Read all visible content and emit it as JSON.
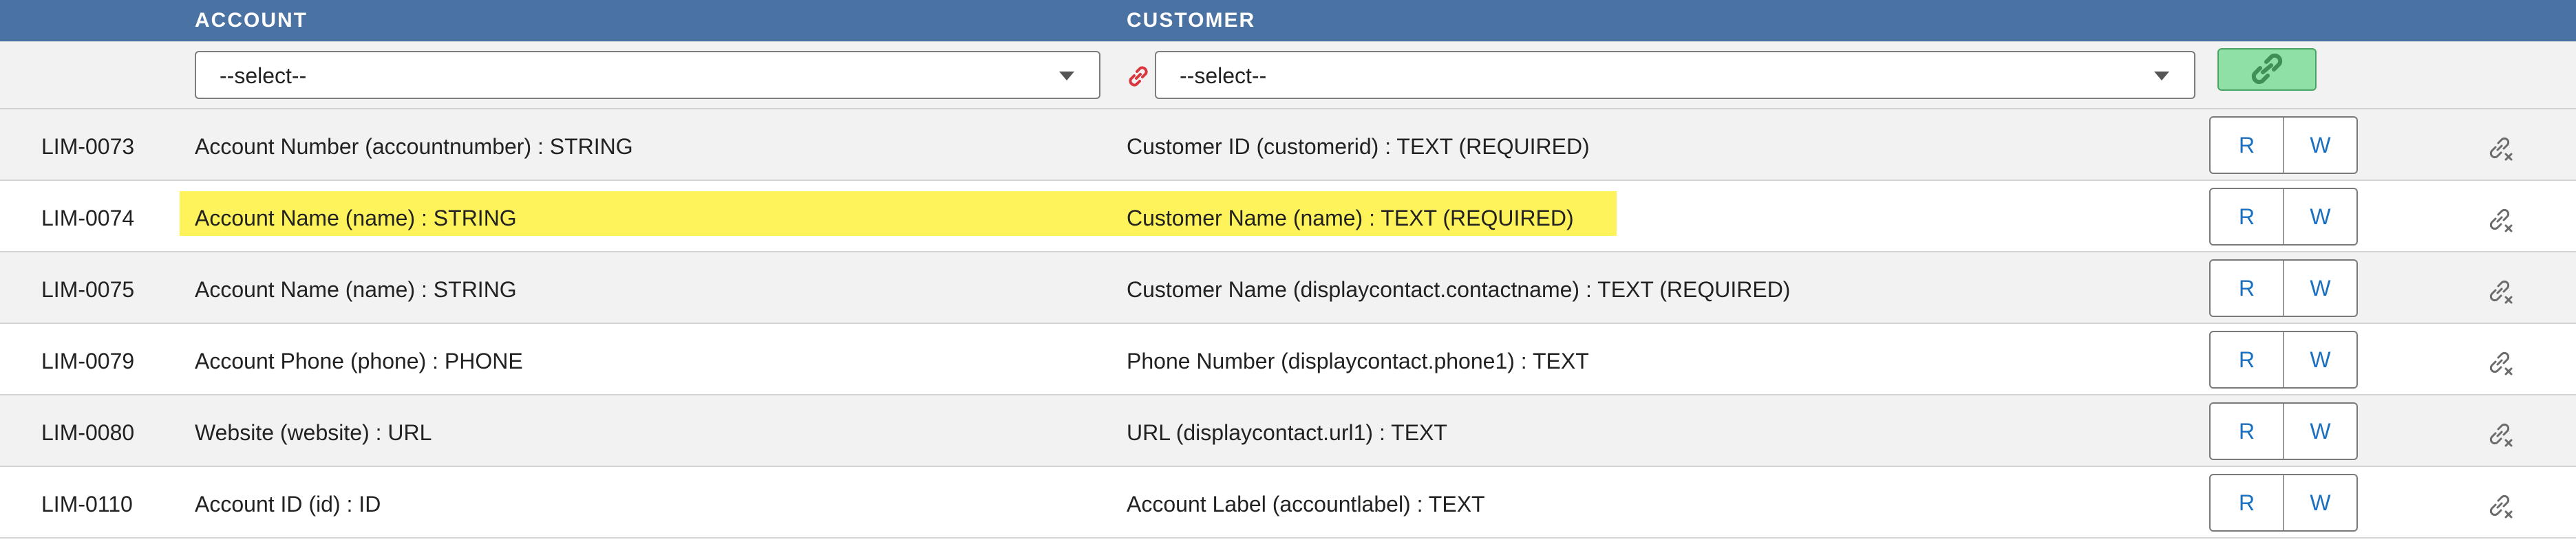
{
  "header": {
    "account_label": "ACCOUNT",
    "customer_label": "CUSTOMER"
  },
  "filter": {
    "account_select": "--select--",
    "customer_select": "--select--",
    "link_icon": "chain-link-icon",
    "link_button_icon": "link-icon"
  },
  "colors": {
    "header_bg": "#4a72a3",
    "highlight": "#fff35c",
    "link_button_bg": "#8fe0a6",
    "rw_text": "#1a6fc0",
    "chain_red": "#d9363e"
  },
  "rows": [
    {
      "id": "LIM-0073",
      "account": "Account Number (accountnumber) : STRING",
      "customer": "Customer ID (customerid) : TEXT (REQUIRED)",
      "r": "R",
      "w": "W",
      "highlighted": false
    },
    {
      "id": "LIM-0074",
      "account": "Account Name (name) : STRING",
      "customer": "Customer Name (name) : TEXT (REQUIRED)",
      "r": "R",
      "w": "W",
      "highlighted": true
    },
    {
      "id": "LIM-0075",
      "account": "Account Name (name) : STRING",
      "customer": "Customer Name (displaycontact.contactname) : TEXT (REQUIRED)",
      "r": "R",
      "w": "W",
      "highlighted": false
    },
    {
      "id": "LIM-0079",
      "account": "Account Phone (phone) : PHONE",
      "customer": "Phone Number (displaycontact.phone1) : TEXT",
      "r": "R",
      "w": "W",
      "highlighted": false
    },
    {
      "id": "LIM-0080",
      "account": "Website (website) : URL",
      "customer": "URL (displaycontact.url1) : TEXT",
      "r": "R",
      "w": "W",
      "highlighted": false
    },
    {
      "id": "LIM-0110",
      "account": "Account ID (id) : ID",
      "customer": "Account Label (accountlabel) : TEXT",
      "r": "R",
      "w": "W",
      "highlighted": false
    }
  ]
}
